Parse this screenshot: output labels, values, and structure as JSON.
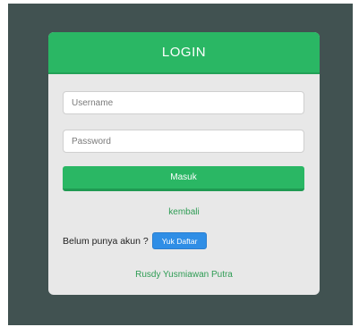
{
  "header": {
    "title": "LOGIN"
  },
  "form": {
    "username_placeholder": "Username",
    "password_placeholder": "Password",
    "submit_label": "Masuk"
  },
  "links": {
    "back": "kembali"
  },
  "signup": {
    "prompt": "Belum punya akun ?",
    "button_label": "Yuk Daftar"
  },
  "footer": {
    "author": "Rusdy Yusmiawan Putra"
  },
  "colors": {
    "backdrop": "#415251",
    "card": "#e8e8e8",
    "accent_green": "#2ab764",
    "signup_blue": "#2f8ee6"
  }
}
